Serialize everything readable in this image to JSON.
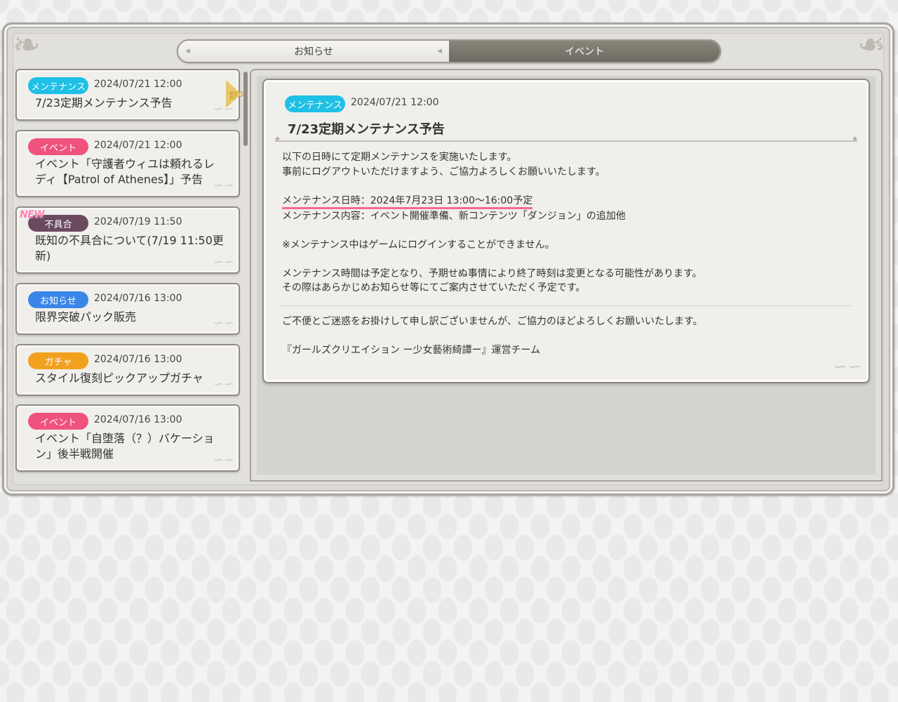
{
  "tabs": [
    {
      "label": "お知らせ",
      "active": false
    },
    {
      "label": "イベント",
      "active": true
    }
  ],
  "colors": {
    "maintenance": "#1ec0e6",
    "event": "#f0527e",
    "bug": "#6b4a5e",
    "notice": "#3a86e8",
    "gacha": "#f2a11f",
    "highlight": "#f56a95"
  },
  "news": [
    {
      "badge": "メンテナンス",
      "badge_type": "maintenance",
      "date": "2024/07/21 12:00",
      "title": "7/23定期メンテナンス予告",
      "selected": true,
      "is_new": false
    },
    {
      "badge": "イベント",
      "badge_type": "event",
      "date": "2024/07/21 12:00",
      "title": "イベント「守護者ウィユは頼れるレディ【Patrol of Athenes】」予告",
      "selected": false,
      "is_new": false
    },
    {
      "badge": "不具合",
      "badge_type": "bug",
      "date": "2024/07/19 11:50",
      "title": "既知の不具合について(7/19 11:50更新)",
      "selected": false,
      "is_new": true,
      "new_label": "NEW"
    },
    {
      "badge": "お知らせ",
      "badge_type": "notice",
      "date": "2024/07/16 13:00",
      "title": "限界突破パック販売",
      "selected": false,
      "is_new": false
    },
    {
      "badge": "ガチャ",
      "badge_type": "gacha",
      "date": "2024/07/16 13:00",
      "title": "スタイル復刻ピックアップガチャ",
      "selected": false,
      "is_new": false
    },
    {
      "badge": "イベント",
      "badge_type": "event",
      "date": "2024/07/16 13:00",
      "title": "イベント「自堕落（？）バケーション」後半戦開催",
      "selected": false,
      "is_new": false
    }
  ],
  "detail": {
    "badge": "メンテナンス",
    "date": "2024/07/21 12:00",
    "title": "7/23定期メンテナンス予告",
    "line1": "以下の日時にて定期メンテナンスを実施いたします。",
    "line2": "事前にログアウトいただけますよう、ご協力よろしくお願いいたします。",
    "schedule": "メンテナンス日時：2024年7月23日 13:00～16:00予定",
    "content": "メンテナンス内容：イベント開催準備、新コンテンツ「ダンジョン」の追加他",
    "note": "※メンテナンス中はゲームにログインすることができません。",
    "caveat1": "メンテナンス時間は予定となり、予期せぬ事情により終了時刻は変更となる可能性があります。",
    "caveat2": "その際はあらかじめお知らせ等にてご案内させていただく予定です。",
    "apology": "ご不便とご迷惑をお掛けして申し訳ございませんが、ご協力のほどよろしくお願いいたします。",
    "signature": "『ガールズクリエイション ー少女藝術綺譚ー』運営チーム"
  }
}
